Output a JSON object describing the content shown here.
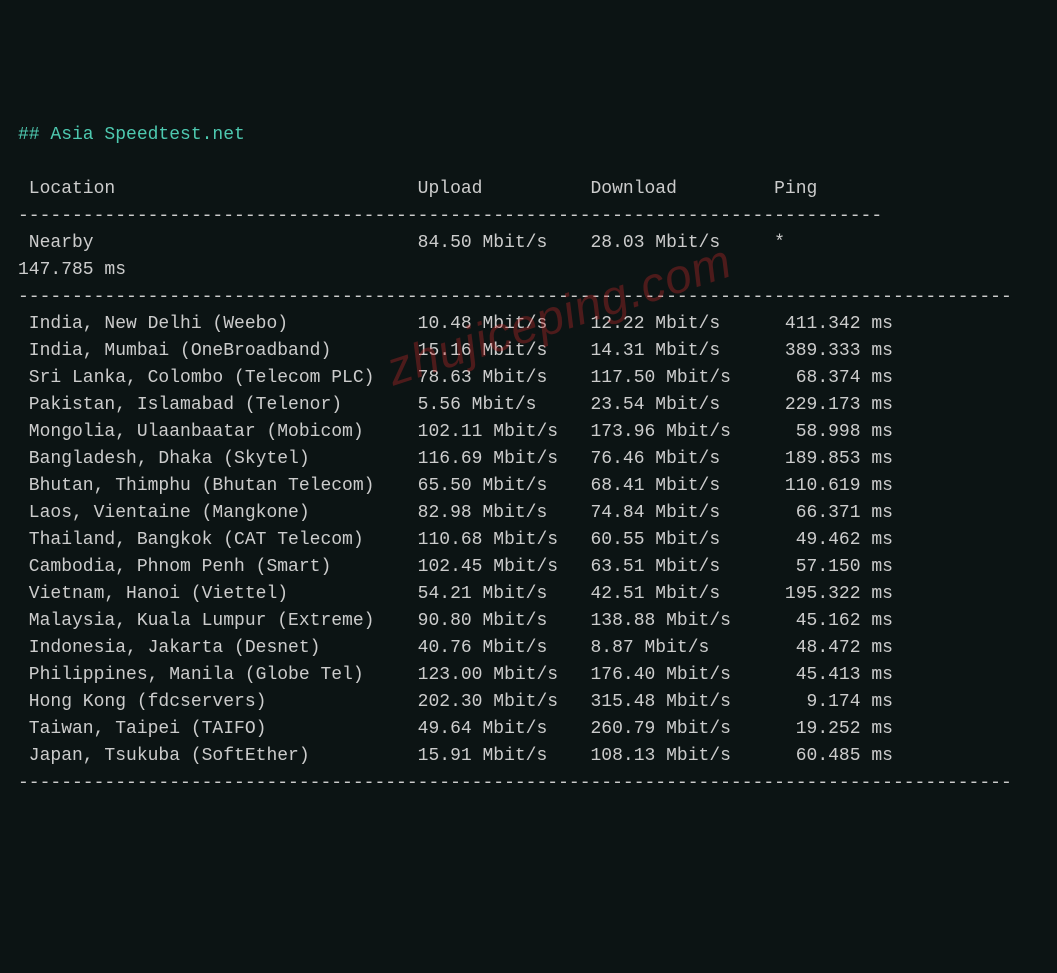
{
  "title": "## Asia Speedtest.net",
  "headers": {
    "location": "Location",
    "upload": "Upload",
    "download": "Download",
    "ping": "Ping"
  },
  "nearby": {
    "label": "Nearby",
    "upload": "84.50 Mbit/s",
    "download": "28.03 Mbit/s",
    "ping": "*",
    "extra": "147.785 ms"
  },
  "rows": [
    {
      "location": "India, New Delhi (Weebo)",
      "upload": "10.48 Mbit/s",
      "download": "12.22 Mbit/s",
      "ping": "411.342 ms"
    },
    {
      "location": "India, Mumbai (OneBroadband)",
      "upload": "15.16 Mbit/s",
      "download": "14.31 Mbit/s",
      "ping": "389.333 ms"
    },
    {
      "location": "Sri Lanka, Colombo (Telecom PLC)",
      "upload": "78.63 Mbit/s",
      "download": "117.50 Mbit/s",
      "ping": "68.374 ms"
    },
    {
      "location": "Pakistan, Islamabad (Telenor)",
      "upload": "5.56 Mbit/s",
      "download": "23.54 Mbit/s",
      "ping": "229.173 ms"
    },
    {
      "location": "Mongolia, Ulaanbaatar (Mobicom)",
      "upload": "102.11 Mbit/s",
      "download": "173.96 Mbit/s",
      "ping": "58.998 ms"
    },
    {
      "location": "Bangladesh, Dhaka (Skytel)",
      "upload": "116.69 Mbit/s",
      "download": "76.46 Mbit/s",
      "ping": "189.853 ms"
    },
    {
      "location": "Bhutan, Thimphu (Bhutan Telecom)",
      "upload": "65.50 Mbit/s",
      "download": "68.41 Mbit/s",
      "ping": "110.619 ms"
    },
    {
      "location": "Laos, Vientaine (Mangkone)",
      "upload": "82.98 Mbit/s",
      "download": "74.84 Mbit/s",
      "ping": "66.371 ms"
    },
    {
      "location": "Thailand, Bangkok (CAT Telecom)",
      "upload": "110.68 Mbit/s",
      "download": "60.55 Mbit/s",
      "ping": "49.462 ms"
    },
    {
      "location": "Cambodia, Phnom Penh (Smart)",
      "upload": "102.45 Mbit/s",
      "download": "63.51 Mbit/s",
      "ping": "57.150 ms"
    },
    {
      "location": "Vietnam, Hanoi (Viettel)",
      "upload": "54.21 Mbit/s",
      "download": "42.51 Mbit/s",
      "ping": "195.322 ms"
    },
    {
      "location": "Malaysia, Kuala Lumpur (Extreme)",
      "upload": "90.80 Mbit/s",
      "download": "138.88 Mbit/s",
      "ping": "45.162 ms"
    },
    {
      "location": "Indonesia, Jakarta (Desnet)",
      "upload": "40.76 Mbit/s",
      "download": "8.87 Mbit/s",
      "ping": "48.472 ms"
    },
    {
      "location": "Philippines, Manila (Globe Tel)",
      "upload": "123.00 Mbit/s",
      "download": "176.40 Mbit/s",
      "ping": "45.413 ms"
    },
    {
      "location": "Hong Kong (fdcservers)",
      "upload": "202.30 Mbit/s",
      "download": "315.48 Mbit/s",
      "ping": "9.174 ms"
    },
    {
      "location": "Taiwan, Taipei (TAIFO)",
      "upload": "49.64 Mbit/s",
      "download": "260.79 Mbit/s",
      "ping": "19.252 ms"
    },
    {
      "location": "Japan, Tsukuba (SoftEther)",
      "upload": "15.91 Mbit/s",
      "download": "108.13 Mbit/s",
      "ping": "60.485 ms"
    }
  ],
  "watermark": "zhujiceping.com",
  "layout": {
    "col_location": 36,
    "col_upload": 16,
    "col_download": 17,
    "col_ping": 11,
    "rule_width": 92,
    "short_rule_width": 80
  }
}
